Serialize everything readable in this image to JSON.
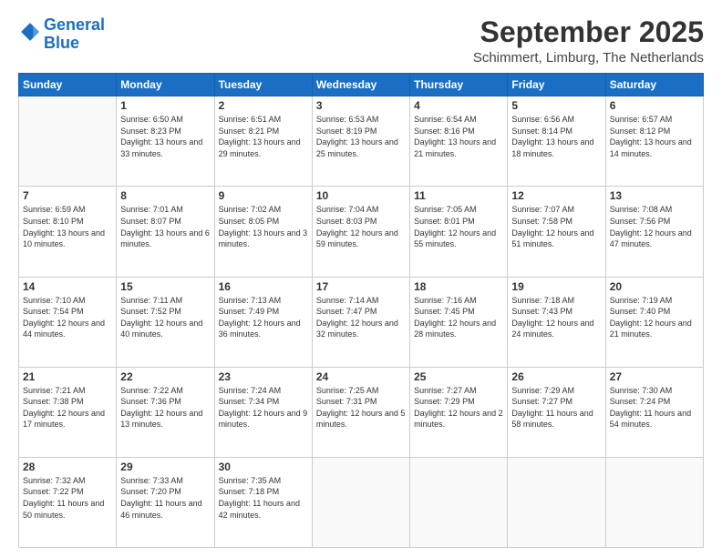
{
  "logo": {
    "line1": "General",
    "line2": "Blue"
  },
  "header": {
    "month": "September 2025",
    "location": "Schimmert, Limburg, The Netherlands"
  },
  "weekdays": [
    "Sunday",
    "Monday",
    "Tuesday",
    "Wednesday",
    "Thursday",
    "Friday",
    "Saturday"
  ],
  "weeks": [
    [
      {
        "day": "",
        "sunrise": "",
        "sunset": "",
        "daylight": ""
      },
      {
        "day": "1",
        "sunrise": "Sunrise: 6:50 AM",
        "sunset": "Sunset: 8:23 PM",
        "daylight": "Daylight: 13 hours and 33 minutes."
      },
      {
        "day": "2",
        "sunrise": "Sunrise: 6:51 AM",
        "sunset": "Sunset: 8:21 PM",
        "daylight": "Daylight: 13 hours and 29 minutes."
      },
      {
        "day": "3",
        "sunrise": "Sunrise: 6:53 AM",
        "sunset": "Sunset: 8:19 PM",
        "daylight": "Daylight: 13 hours and 25 minutes."
      },
      {
        "day": "4",
        "sunrise": "Sunrise: 6:54 AM",
        "sunset": "Sunset: 8:16 PM",
        "daylight": "Daylight: 13 hours and 21 minutes."
      },
      {
        "day": "5",
        "sunrise": "Sunrise: 6:56 AM",
        "sunset": "Sunset: 8:14 PM",
        "daylight": "Daylight: 13 hours and 18 minutes."
      },
      {
        "day": "6",
        "sunrise": "Sunrise: 6:57 AM",
        "sunset": "Sunset: 8:12 PM",
        "daylight": "Daylight: 13 hours and 14 minutes."
      }
    ],
    [
      {
        "day": "7",
        "sunrise": "Sunrise: 6:59 AM",
        "sunset": "Sunset: 8:10 PM",
        "daylight": "Daylight: 13 hours and 10 minutes."
      },
      {
        "day": "8",
        "sunrise": "Sunrise: 7:01 AM",
        "sunset": "Sunset: 8:07 PM",
        "daylight": "Daylight: 13 hours and 6 minutes."
      },
      {
        "day": "9",
        "sunrise": "Sunrise: 7:02 AM",
        "sunset": "Sunset: 8:05 PM",
        "daylight": "Daylight: 13 hours and 3 minutes."
      },
      {
        "day": "10",
        "sunrise": "Sunrise: 7:04 AM",
        "sunset": "Sunset: 8:03 PM",
        "daylight": "Daylight: 12 hours and 59 minutes."
      },
      {
        "day": "11",
        "sunrise": "Sunrise: 7:05 AM",
        "sunset": "Sunset: 8:01 PM",
        "daylight": "Daylight: 12 hours and 55 minutes."
      },
      {
        "day": "12",
        "sunrise": "Sunrise: 7:07 AM",
        "sunset": "Sunset: 7:58 PM",
        "daylight": "Daylight: 12 hours and 51 minutes."
      },
      {
        "day": "13",
        "sunrise": "Sunrise: 7:08 AM",
        "sunset": "Sunset: 7:56 PM",
        "daylight": "Daylight: 12 hours and 47 minutes."
      }
    ],
    [
      {
        "day": "14",
        "sunrise": "Sunrise: 7:10 AM",
        "sunset": "Sunset: 7:54 PM",
        "daylight": "Daylight: 12 hours and 44 minutes."
      },
      {
        "day": "15",
        "sunrise": "Sunrise: 7:11 AM",
        "sunset": "Sunset: 7:52 PM",
        "daylight": "Daylight: 12 hours and 40 minutes."
      },
      {
        "day": "16",
        "sunrise": "Sunrise: 7:13 AM",
        "sunset": "Sunset: 7:49 PM",
        "daylight": "Daylight: 12 hours and 36 minutes."
      },
      {
        "day": "17",
        "sunrise": "Sunrise: 7:14 AM",
        "sunset": "Sunset: 7:47 PM",
        "daylight": "Daylight: 12 hours and 32 minutes."
      },
      {
        "day": "18",
        "sunrise": "Sunrise: 7:16 AM",
        "sunset": "Sunset: 7:45 PM",
        "daylight": "Daylight: 12 hours and 28 minutes."
      },
      {
        "day": "19",
        "sunrise": "Sunrise: 7:18 AM",
        "sunset": "Sunset: 7:43 PM",
        "daylight": "Daylight: 12 hours and 24 minutes."
      },
      {
        "day": "20",
        "sunrise": "Sunrise: 7:19 AM",
        "sunset": "Sunset: 7:40 PM",
        "daylight": "Daylight: 12 hours and 21 minutes."
      }
    ],
    [
      {
        "day": "21",
        "sunrise": "Sunrise: 7:21 AM",
        "sunset": "Sunset: 7:38 PM",
        "daylight": "Daylight: 12 hours and 17 minutes."
      },
      {
        "day": "22",
        "sunrise": "Sunrise: 7:22 AM",
        "sunset": "Sunset: 7:36 PM",
        "daylight": "Daylight: 12 hours and 13 minutes."
      },
      {
        "day": "23",
        "sunrise": "Sunrise: 7:24 AM",
        "sunset": "Sunset: 7:34 PM",
        "daylight": "Daylight: 12 hours and 9 minutes."
      },
      {
        "day": "24",
        "sunrise": "Sunrise: 7:25 AM",
        "sunset": "Sunset: 7:31 PM",
        "daylight": "Daylight: 12 hours and 5 minutes."
      },
      {
        "day": "25",
        "sunrise": "Sunrise: 7:27 AM",
        "sunset": "Sunset: 7:29 PM",
        "daylight": "Daylight: 12 hours and 2 minutes."
      },
      {
        "day": "26",
        "sunrise": "Sunrise: 7:29 AM",
        "sunset": "Sunset: 7:27 PM",
        "daylight": "Daylight: 11 hours and 58 minutes."
      },
      {
        "day": "27",
        "sunrise": "Sunrise: 7:30 AM",
        "sunset": "Sunset: 7:24 PM",
        "daylight": "Daylight: 11 hours and 54 minutes."
      }
    ],
    [
      {
        "day": "28",
        "sunrise": "Sunrise: 7:32 AM",
        "sunset": "Sunset: 7:22 PM",
        "daylight": "Daylight: 11 hours and 50 minutes."
      },
      {
        "day": "29",
        "sunrise": "Sunrise: 7:33 AM",
        "sunset": "Sunset: 7:20 PM",
        "daylight": "Daylight: 11 hours and 46 minutes."
      },
      {
        "day": "30",
        "sunrise": "Sunrise: 7:35 AM",
        "sunset": "Sunset: 7:18 PM",
        "daylight": "Daylight: 11 hours and 42 minutes."
      },
      {
        "day": "",
        "sunrise": "",
        "sunset": "",
        "daylight": ""
      },
      {
        "day": "",
        "sunrise": "",
        "sunset": "",
        "daylight": ""
      },
      {
        "day": "",
        "sunrise": "",
        "sunset": "",
        "daylight": ""
      },
      {
        "day": "",
        "sunrise": "",
        "sunset": "",
        "daylight": ""
      }
    ]
  ]
}
